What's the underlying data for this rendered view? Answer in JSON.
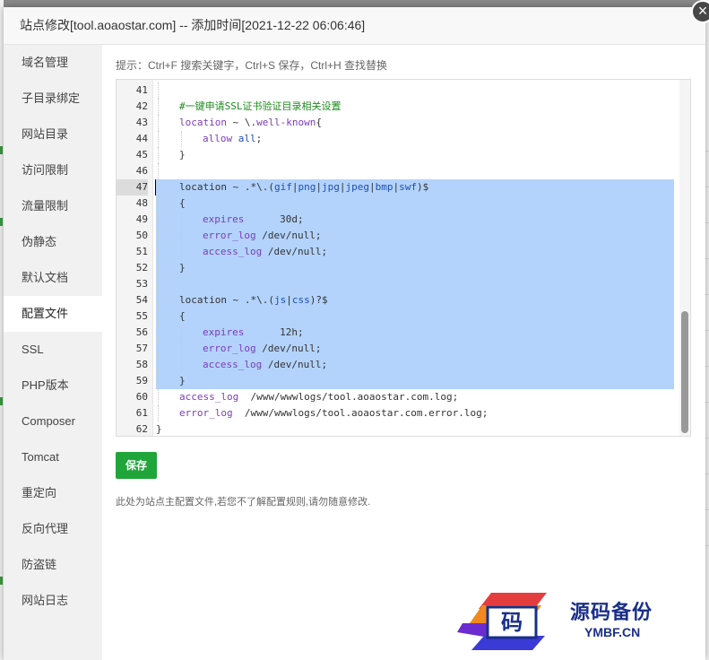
{
  "window": {
    "title": "站点修改[tool.aoaostar.com] -- 添加时间[2021-12-22 06:06:46]",
    "close_icon": "close-icon",
    "close_glyph": "×"
  },
  "sidebar": {
    "items": [
      {
        "label": "域名管理",
        "active": false
      },
      {
        "label": "子目录绑定",
        "active": false
      },
      {
        "label": "网站目录",
        "active": false
      },
      {
        "label": "访问限制",
        "active": false
      },
      {
        "label": "流量限制",
        "active": false
      },
      {
        "label": "伪静态",
        "active": false
      },
      {
        "label": "默认文档",
        "active": false
      },
      {
        "label": "配置文件",
        "active": true
      },
      {
        "label": "SSL",
        "active": false
      },
      {
        "label": "PHP版本",
        "active": false
      },
      {
        "label": "Composer",
        "active": false
      },
      {
        "label": "Tomcat",
        "active": false
      },
      {
        "label": "重定向",
        "active": false
      },
      {
        "label": "反向代理",
        "active": false
      },
      {
        "label": "防盗链",
        "active": false
      },
      {
        "label": "网站日志",
        "active": false
      }
    ]
  },
  "main": {
    "tip": "提示：Ctrl+F 搜索关键字，Ctrl+S 保存，Ctrl+H 查找替换",
    "save_label": "保存",
    "note": "此处为站点主配置文件,若您不了解配置规则,请勿随意修改."
  },
  "editor": {
    "cursor_line": 47,
    "selection": [
      47,
      59
    ],
    "lines": [
      {
        "n": "41",
        "indent": 1,
        "tokens": []
      },
      {
        "n": "42",
        "indent": 1,
        "tokens": [
          {
            "t": "#一键申请SSL证书验证目录相关设置",
            "c": "comment"
          }
        ]
      },
      {
        "n": "43",
        "indent": 1,
        "tokens": [
          {
            "t": "location",
            "c": "kw"
          },
          {
            "t": " ~ \\.",
            "c": "plain"
          },
          {
            "t": "well-known",
            "c": "kw"
          },
          {
            "t": "{",
            "c": "plain"
          }
        ]
      },
      {
        "n": "44",
        "indent": 2,
        "tokens": [
          {
            "t": "allow",
            "c": "kw"
          },
          {
            "t": " ",
            "c": "plain"
          },
          {
            "t": "all",
            "c": "str"
          },
          {
            "t": ";",
            "c": "plain"
          }
        ]
      },
      {
        "n": "45",
        "indent": 1,
        "tokens": [
          {
            "t": "}",
            "c": "plain"
          }
        ]
      },
      {
        "n": "46",
        "indent": 1,
        "tokens": []
      },
      {
        "n": "47",
        "indent": 1,
        "tokens": [
          {
            "t": "location ~ .*\\.(",
            "c": "plain"
          },
          {
            "t": "gif",
            "c": "str"
          },
          {
            "t": "|",
            "c": "plain"
          },
          {
            "t": "png",
            "c": "str"
          },
          {
            "t": "|",
            "c": "plain"
          },
          {
            "t": "jpg",
            "c": "str"
          },
          {
            "t": "|",
            "c": "plain"
          },
          {
            "t": "jpeg",
            "c": "str"
          },
          {
            "t": "|",
            "c": "plain"
          },
          {
            "t": "bmp",
            "c": "str"
          },
          {
            "t": "|",
            "c": "plain"
          },
          {
            "t": "swf",
            "c": "str"
          },
          {
            "t": ")$",
            "c": "plain"
          }
        ]
      },
      {
        "n": "48",
        "indent": 1,
        "tokens": [
          {
            "t": "{",
            "c": "plain"
          }
        ]
      },
      {
        "n": "49",
        "indent": 2,
        "tokens": [
          {
            "t": "expires",
            "c": "kw"
          },
          {
            "t": "      30d;",
            "c": "plain"
          }
        ]
      },
      {
        "n": "50",
        "indent": 2,
        "tokens": [
          {
            "t": "error_log",
            "c": "kw"
          },
          {
            "t": " /dev/null;",
            "c": "plain"
          }
        ]
      },
      {
        "n": "51",
        "indent": 2,
        "tokens": [
          {
            "t": "access_log",
            "c": "kw"
          },
          {
            "t": " /dev/null;",
            "c": "plain"
          }
        ]
      },
      {
        "n": "52",
        "indent": 1,
        "tokens": [
          {
            "t": "}",
            "c": "plain"
          }
        ]
      },
      {
        "n": "53",
        "indent": 1,
        "tokens": []
      },
      {
        "n": "54",
        "indent": 1,
        "tokens": [
          {
            "t": "location ~ .*\\.(",
            "c": "plain"
          },
          {
            "t": "js",
            "c": "str"
          },
          {
            "t": "|",
            "c": "plain"
          },
          {
            "t": "css",
            "c": "str"
          },
          {
            "t": ")?$",
            "c": "plain"
          }
        ]
      },
      {
        "n": "55",
        "indent": 1,
        "tokens": [
          {
            "t": "{",
            "c": "plain"
          }
        ]
      },
      {
        "n": "56",
        "indent": 2,
        "tokens": [
          {
            "t": "expires",
            "c": "kw"
          },
          {
            "t": "      12h;",
            "c": "plain"
          }
        ]
      },
      {
        "n": "57",
        "indent": 2,
        "tokens": [
          {
            "t": "error_log",
            "c": "kw"
          },
          {
            "t": " /dev/null;",
            "c": "plain"
          }
        ]
      },
      {
        "n": "58",
        "indent": 2,
        "tokens": [
          {
            "t": "access_log",
            "c": "kw"
          },
          {
            "t": " /dev/null;",
            "c": "plain"
          }
        ]
      },
      {
        "n": "59",
        "indent": 1,
        "tokens": [
          {
            "t": "}",
            "c": "plain"
          }
        ]
      },
      {
        "n": "60",
        "indent": 1,
        "tokens": [
          {
            "t": "access_log",
            "c": "kw"
          },
          {
            "t": "  /www/wwwlogs/tool.aoaostar.com.log;",
            "c": "plain"
          }
        ]
      },
      {
        "n": "61",
        "indent": 1,
        "tokens": [
          {
            "t": "error_log",
            "c": "kw"
          },
          {
            "t": "  /www/wwwlogs/tool.aoaostar.com.error.log;",
            "c": "plain"
          }
        ]
      },
      {
        "n": "62",
        "indent": 0,
        "tokens": [
          {
            "t": "}",
            "c": "plain"
          }
        ]
      }
    ]
  },
  "watermark": {
    "glyph": "码",
    "text": "源码备份",
    "sub": "YMBF.CN"
  },
  "colors": {
    "accent": "#20a53a",
    "selection": "#b3d3fc",
    "comment": "#1e8b1e",
    "keyword": "#7a3db8",
    "string": "#1f4fb0"
  }
}
